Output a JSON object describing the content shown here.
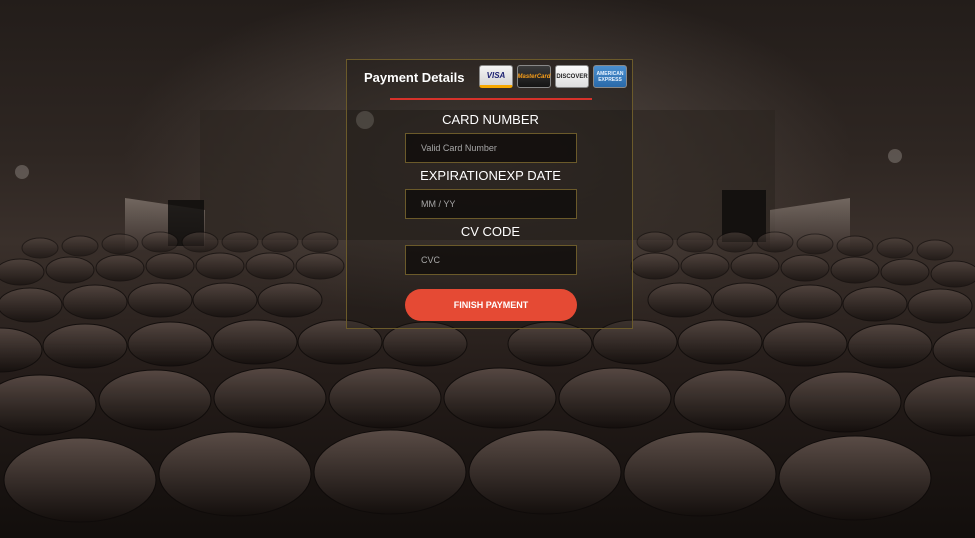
{
  "payment": {
    "title": "Payment Details",
    "accepted_cards": [
      {
        "name": "visa-card-logo",
        "label": "VISA"
      },
      {
        "name": "mastercard-card-logo",
        "label": "MasterCard"
      },
      {
        "name": "discover-card-logo",
        "label": "DISCOVER"
      },
      {
        "name": "amex-card-logo",
        "label": "AMERICAN EXPRESS"
      }
    ],
    "card_number": {
      "label": "CARD NUMBER",
      "placeholder": "Valid Card Number",
      "value": ""
    },
    "expiration": {
      "label": "EXPIRATIONEXP DATE",
      "placeholder": "MM / YY",
      "value": ""
    },
    "cvc": {
      "label": "CV CODE",
      "placeholder": "CVC",
      "value": ""
    },
    "submit_label": "FINISH PAYMENT"
  },
  "colors": {
    "accent": "#e54a34",
    "divider": "#d7322a",
    "panel_border": "#6b5a2a"
  }
}
